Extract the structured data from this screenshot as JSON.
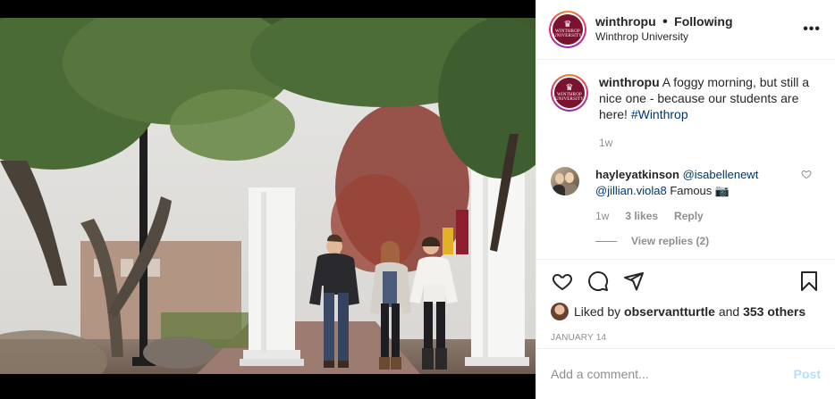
{
  "post": {
    "image_alt": "Three students walking through white columns on a foggy morning"
  },
  "header": {
    "avatar_logo_text": "WINTHROP",
    "avatar_logo_sub": "UNIVERSITY",
    "username": "winthropu",
    "separator": "•",
    "following_label": "Following",
    "location": "Winthrop University",
    "more_label": "•••"
  },
  "caption": {
    "username": "winthropu",
    "text": "A foggy morning, but still a nice one - because our students are here!",
    "hashtag": "#Winthrop",
    "time": "1w"
  },
  "comments": [
    {
      "username": "hayleyatkinson",
      "mention1": "@isabellenewt",
      "mention2": "@jillian.viola8",
      "text": "Famous",
      "emoji": "📷",
      "time": "1w",
      "likes": "3 likes",
      "reply_label": "Reply",
      "view_replies": "View replies (2)"
    }
  ],
  "actions": {
    "like_icon": "heart-icon",
    "comment_icon": "comment-icon",
    "share_icon": "share-icon",
    "save_icon": "bookmark-icon"
  },
  "likes": {
    "prefix": "Liked by",
    "user": "observantturtle",
    "and": "and",
    "others": "353 others"
  },
  "date": "JANUARY 14",
  "add_comment": {
    "placeholder": "Add a comment...",
    "post_label": "Post"
  },
  "colors": {
    "brand": "#7a1230",
    "link": "#00376b",
    "muted": "#8e8e8e",
    "post_disabled": "#b2dffc"
  }
}
